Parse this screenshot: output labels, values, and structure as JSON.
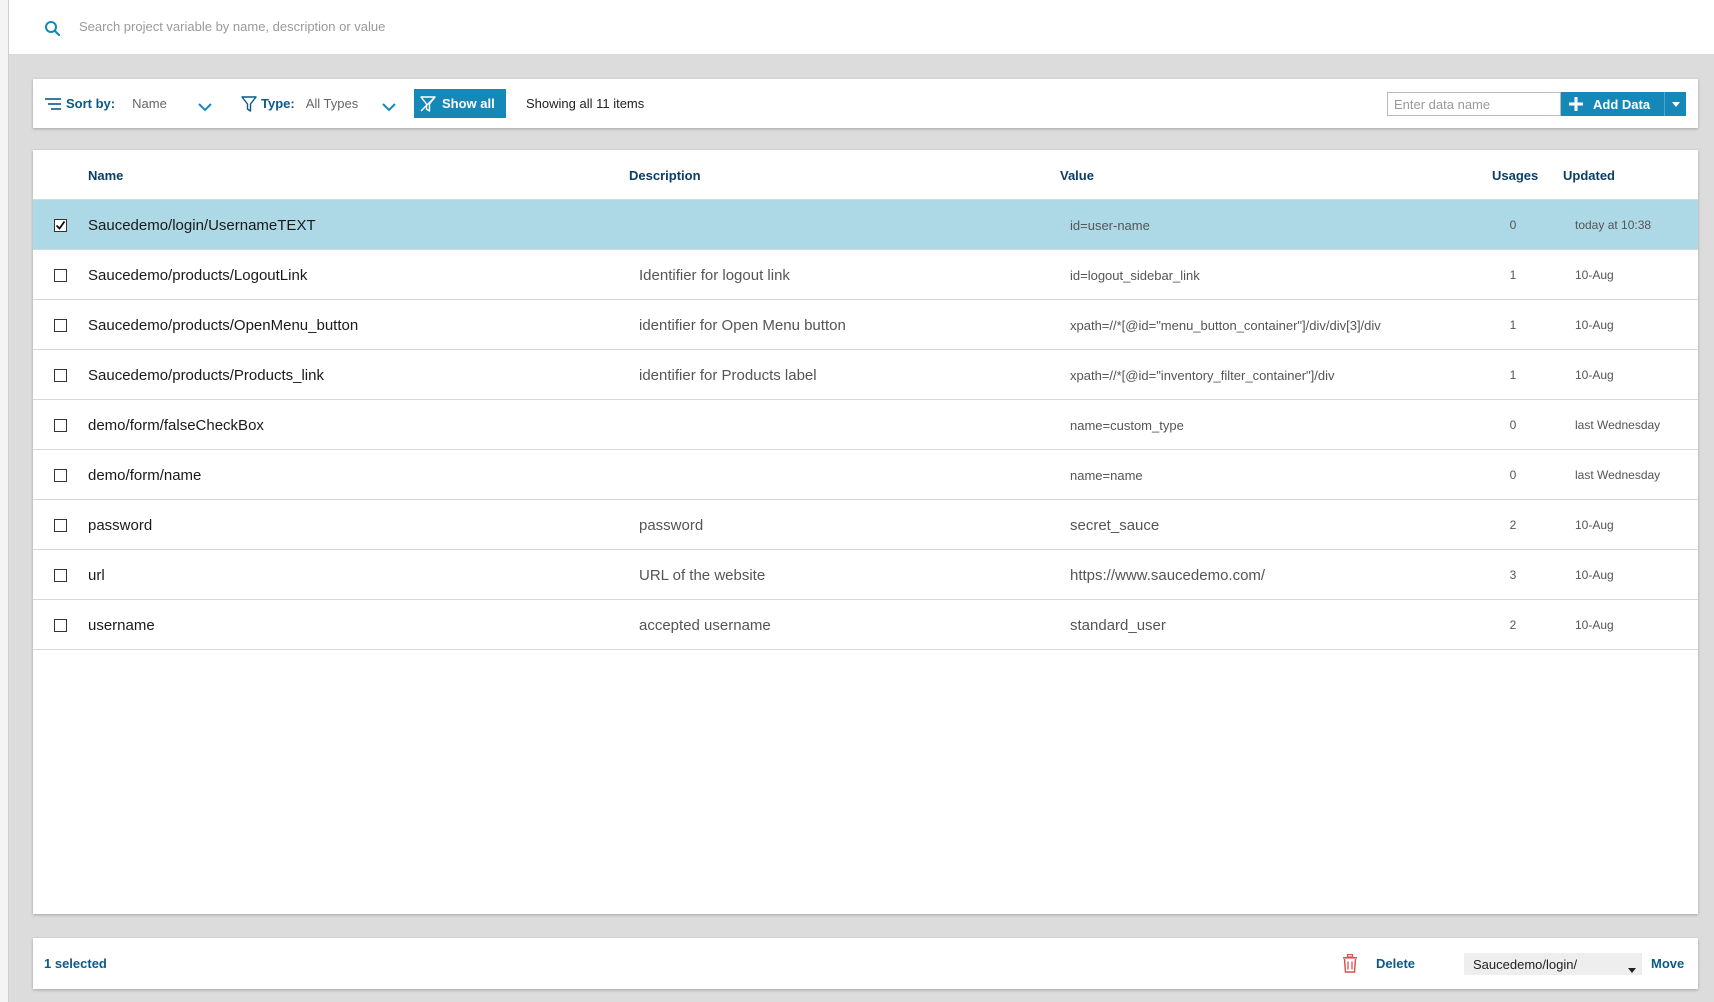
{
  "search": {
    "placeholder": "Search project variable by name, description or value"
  },
  "toolbar": {
    "sort_label": "Sort by:",
    "sort_value": "Name",
    "type_label": "Type:",
    "type_value": "All Types",
    "show_all_label": "Show all",
    "showing_text": "Showing all 11 items",
    "data_name_placeholder": "Enter data name",
    "add_data_label": "Add Data"
  },
  "table": {
    "columns": {
      "name": "Name",
      "description": "Description",
      "value": "Value",
      "usages": "Usages",
      "updated": "Updated"
    },
    "rows": [
      {
        "selected": true,
        "name": "Saucedemo/login/UsernameTEXT",
        "description": "",
        "value": "id=user-name",
        "usages": "0",
        "updated": "today at 10:38"
      },
      {
        "selected": false,
        "name": "Saucedemo/products/LogoutLink",
        "description": "Identifier for logout link",
        "value": "id=logout_sidebar_link",
        "usages": "1",
        "updated": "10-Aug"
      },
      {
        "selected": false,
        "name": "Saucedemo/products/OpenMenu_button",
        "description": "identifier for Open Menu button",
        "value": "xpath=//*[@id=\"menu_button_container\"]/div/div[3]/div",
        "usages": "1",
        "updated": "10-Aug"
      },
      {
        "selected": false,
        "name": "Saucedemo/products/Products_link",
        "description": "identifier for Products label",
        "value": "xpath=//*[@id=\"inventory_filter_container\"]/div",
        "usages": "1",
        "updated": "10-Aug"
      },
      {
        "selected": false,
        "name": "demo/form/falseCheckBox",
        "description": "",
        "value": "name=custom_type",
        "usages": "0",
        "updated": "last Wednesday"
      },
      {
        "selected": false,
        "name": "demo/form/name",
        "description": "",
        "value": "name=name",
        "usages": "0",
        "updated": "last Wednesday"
      },
      {
        "selected": false,
        "name": "password",
        "description": "password",
        "value": "secret_sauce",
        "usages": "2",
        "updated": "10-Aug"
      },
      {
        "selected": false,
        "name": "url",
        "description": "URL of the website",
        "value": "https://www.saucedemo.com/",
        "usages": "3",
        "updated": "10-Aug"
      },
      {
        "selected": false,
        "name": "username",
        "description": "accepted username",
        "value": "standard_user",
        "usages": "2",
        "updated": "10-Aug"
      }
    ]
  },
  "footer": {
    "selected_text": "1 selected",
    "delete_label": "Delete",
    "move_target": "Saucedemo/login/",
    "move_label": "Move"
  },
  "colors": {
    "accent": "#1688b8",
    "selected_row": "#add8e6",
    "header_text": "#0b3e66",
    "link_text": "#0b5a8a",
    "delete_icon": "#d9534f"
  },
  "icons": [
    "search-icon",
    "sort-icon",
    "chevron-down-icon",
    "filter-icon",
    "filter-clear-icon",
    "plus-icon",
    "caret-down-icon",
    "check-icon",
    "trash-icon"
  ]
}
